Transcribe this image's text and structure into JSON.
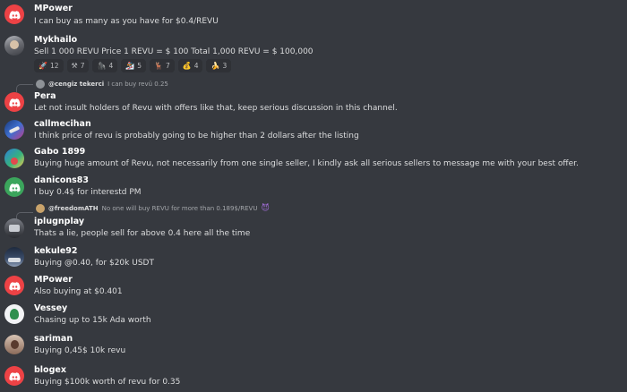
{
  "messages": [
    {
      "name": "MPower",
      "text": "I can buy as many as you have for $0.4/REVU"
    },
    {
      "name": "Mykhailo",
      "text": "Sell 1 000 REVU Price 1 REVU = $ 100 Total 1,000 REVU = $ 100,000"
    },
    {
      "name": "Pera",
      "text": "Let not insult holders of Revu with offers like that, keep serious discussion in this channel."
    },
    {
      "name": "callmecihan",
      "text": "I think price of revu is probably going to be higher than 2 dollars after the listing"
    },
    {
      "name": "Gabo 1899",
      "text": "Buying huge amount of Revu, not necessarily from one single seller, I kindly ask all serious sellers to message me with your best offer."
    },
    {
      "name": "danicons83",
      "text": "I buy 0.4$ for interestd PM"
    },
    {
      "name": "iplugnplay",
      "text": "Thats a lie, people sell for above 0.4 here all the time"
    },
    {
      "name": "kekule92",
      "text": "Buying @0.40, for $20k USDT"
    },
    {
      "name": "MPower",
      "text": "Also buying at $0.401"
    },
    {
      "name": "Vessey",
      "text": "Chasing up to 15k Ada worth"
    },
    {
      "name": "sariman",
      "text": "Buying 0,45$ 10k revu"
    },
    {
      "name": "blogex",
      "text": "Buying $100k worth of revu for 0.35"
    }
  ],
  "reactions": [
    {
      "emoji": "🚀",
      "count": "12",
      "icon": "rocket-icon"
    },
    {
      "emoji": "⚒",
      "count": "7",
      "icon": "pickaxe-icon"
    },
    {
      "emoji": "🦍",
      "count": "4",
      "icon": "gorilla-icon"
    },
    {
      "emoji": "🏂",
      "count": "5",
      "icon": "snowboard-icon"
    },
    {
      "emoji": "🦌",
      "count": "7",
      "icon": "deer-icon"
    },
    {
      "emoji": "💰",
      "count": "4",
      "icon": "money-bag-icon"
    },
    {
      "emoji": "🍌",
      "count": "3",
      "icon": "banana-icon"
    }
  ],
  "replies": [
    {
      "user": "@cengiz tekerci",
      "text": "I can buy revü 0.25"
    },
    {
      "user": "@freedomATH",
      "text": "No one will buy REVU for more than 0.189$/REVU",
      "emoji": "😈"
    }
  ],
  "colors": {
    "background": "#36393f",
    "discord_red": "#ed4245",
    "name": "#ffffff",
    "text": "#dcddde"
  }
}
